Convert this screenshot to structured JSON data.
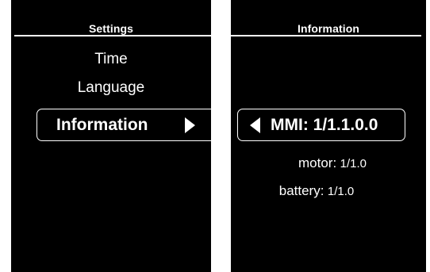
{
  "settings_screen": {
    "header": "Settings",
    "items": [
      {
        "label": "Time"
      },
      {
        "label": "Language"
      }
    ],
    "selected_item": {
      "label": "Information"
    },
    "arrow_icon": "triangle-right-icon"
  },
  "information_screen": {
    "header": "Information",
    "selected_item": {
      "label": "MMI: 1/1.1.0.0"
    },
    "arrow_icon": "triangle-left-icon",
    "rows": [
      {
        "label": "motor:",
        "value": "1/1.0"
      },
      {
        "label": "battery:",
        "value": "1/1.0"
      }
    ]
  },
  "colors": {
    "screen_background": "#000000",
    "text": "#ffffff",
    "page_background": "#ffffff"
  }
}
